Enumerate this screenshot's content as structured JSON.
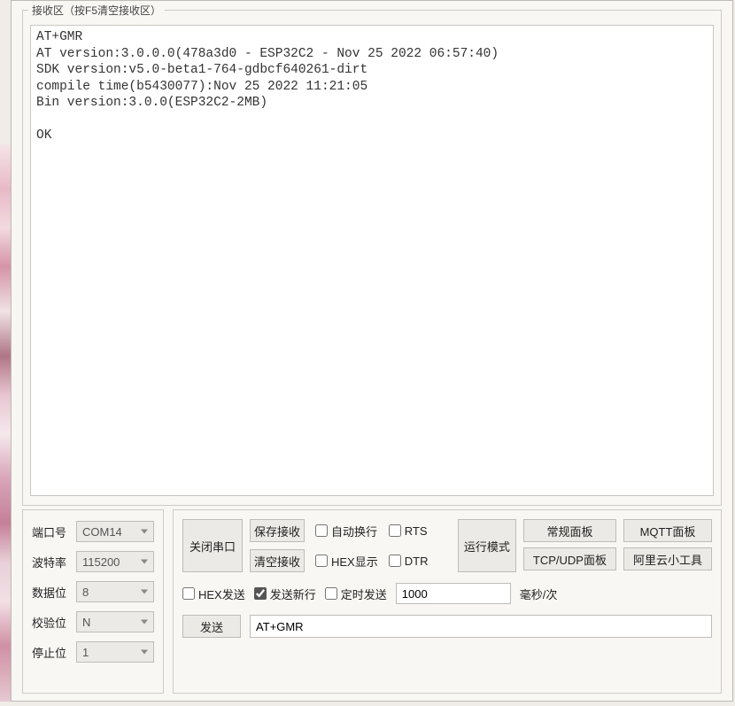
{
  "receive": {
    "legend": "接收区（按F5清空接收区）",
    "content": "AT+GMR\nAT version:3.0.0.0(478a3d0 - ESP32C2 - Nov 25 2022 06:57:40)\nSDK version:v5.0-beta1-764-gdbcf640261-dirt\ncompile time(b5430077):Nov 25 2022 11:21:05\nBin version:3.0.0(ESP32C2-2MB)\n\nOK\n"
  },
  "serial": {
    "port_label": "端口号",
    "port_value": "COM14",
    "baud_label": "波特率",
    "baud_value": "115200",
    "data_label": "数据位",
    "data_value": "8",
    "parity_label": "校验位",
    "parity_value": "N",
    "stop_label": "停止位",
    "stop_value": "1"
  },
  "buttons": {
    "close_port": "关闭串口",
    "save_recv": "保存接收",
    "clear_recv": "清空接收",
    "run_mode": "运行模式",
    "normal_panel": "常规面板",
    "mqtt_panel": "MQTT面板",
    "tcpudp_panel": "TCP/UDP面板",
    "aliyun_tool": "阿里云小工具",
    "send": "发送"
  },
  "checks": {
    "auto_wrap": "自动换行",
    "rts": "RTS",
    "hex_display": "HEX显示",
    "dtr": "DTR",
    "hex_send": "HEX发送",
    "hex_send_checked": false,
    "send_newline": "发送新行",
    "send_newline_checked": true,
    "timed_send": "定时发送",
    "timed_send_checked": false
  },
  "send": {
    "interval": "1000",
    "unit": "毫秒/次",
    "command": "AT+GMR"
  }
}
